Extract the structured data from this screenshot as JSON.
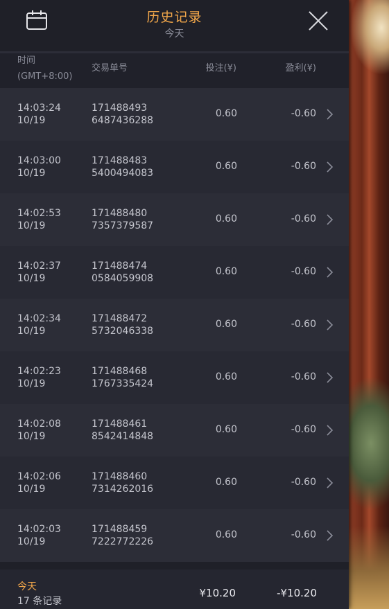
{
  "header": {
    "title": "历史记录",
    "subtitle": "今天"
  },
  "columns": {
    "time": "时间",
    "timezone": "(GMT+8:00)",
    "order": "交易单号",
    "bet": "投注(¥)",
    "profit": "盈利(¥)"
  },
  "rows": [
    {
      "time": "14:03:24",
      "date": "10/19",
      "order1": "171488493",
      "order2": "6487436288",
      "bet": "0.60",
      "profit": "-0.60"
    },
    {
      "time": "14:03:00",
      "date": "10/19",
      "order1": "171488483",
      "order2": "5400494083",
      "bet": "0.60",
      "profit": "-0.60"
    },
    {
      "time": "14:02:53",
      "date": "10/19",
      "order1": "171488480",
      "order2": "7357379587",
      "bet": "0.60",
      "profit": "-0.60"
    },
    {
      "time": "14:02:37",
      "date": "10/19",
      "order1": "171488474",
      "order2": "0584059908",
      "bet": "0.60",
      "profit": "-0.60"
    },
    {
      "time": "14:02:34",
      "date": "10/19",
      "order1": "171488472",
      "order2": "5732046338",
      "bet": "0.60",
      "profit": "-0.60"
    },
    {
      "time": "14:02:23",
      "date": "10/19",
      "order1": "171488468",
      "order2": "1767335424",
      "bet": "0.60",
      "profit": "-0.60"
    },
    {
      "time": "14:02:08",
      "date": "10/19",
      "order1": "171488461",
      "order2": "8542414848",
      "bet": "0.60",
      "profit": "-0.60"
    },
    {
      "time": "14:02:06",
      "date": "10/19",
      "order1": "171488460",
      "order2": "7314262016",
      "bet": "0.60",
      "profit": "-0.60"
    },
    {
      "time": "14:02:03",
      "date": "10/19",
      "order1": "171488459",
      "order2": "7222772226",
      "bet": "0.60",
      "profit": "-0.60"
    }
  ],
  "footer": {
    "period": "今天",
    "count": "17 条记录",
    "total_bet": "¥10.20",
    "total_profit": "-¥10.20"
  },
  "icons": {
    "calendar": "calendar-icon",
    "close": "close-icon",
    "row_chevron": "chevron-right-icon"
  },
  "colors": {
    "accent": "#f0a64a",
    "panel": "#1f2028",
    "row_odd": "#2c2d37",
    "row_even": "#282933",
    "text": "#c4c5cd",
    "muted": "#8a8c98"
  }
}
